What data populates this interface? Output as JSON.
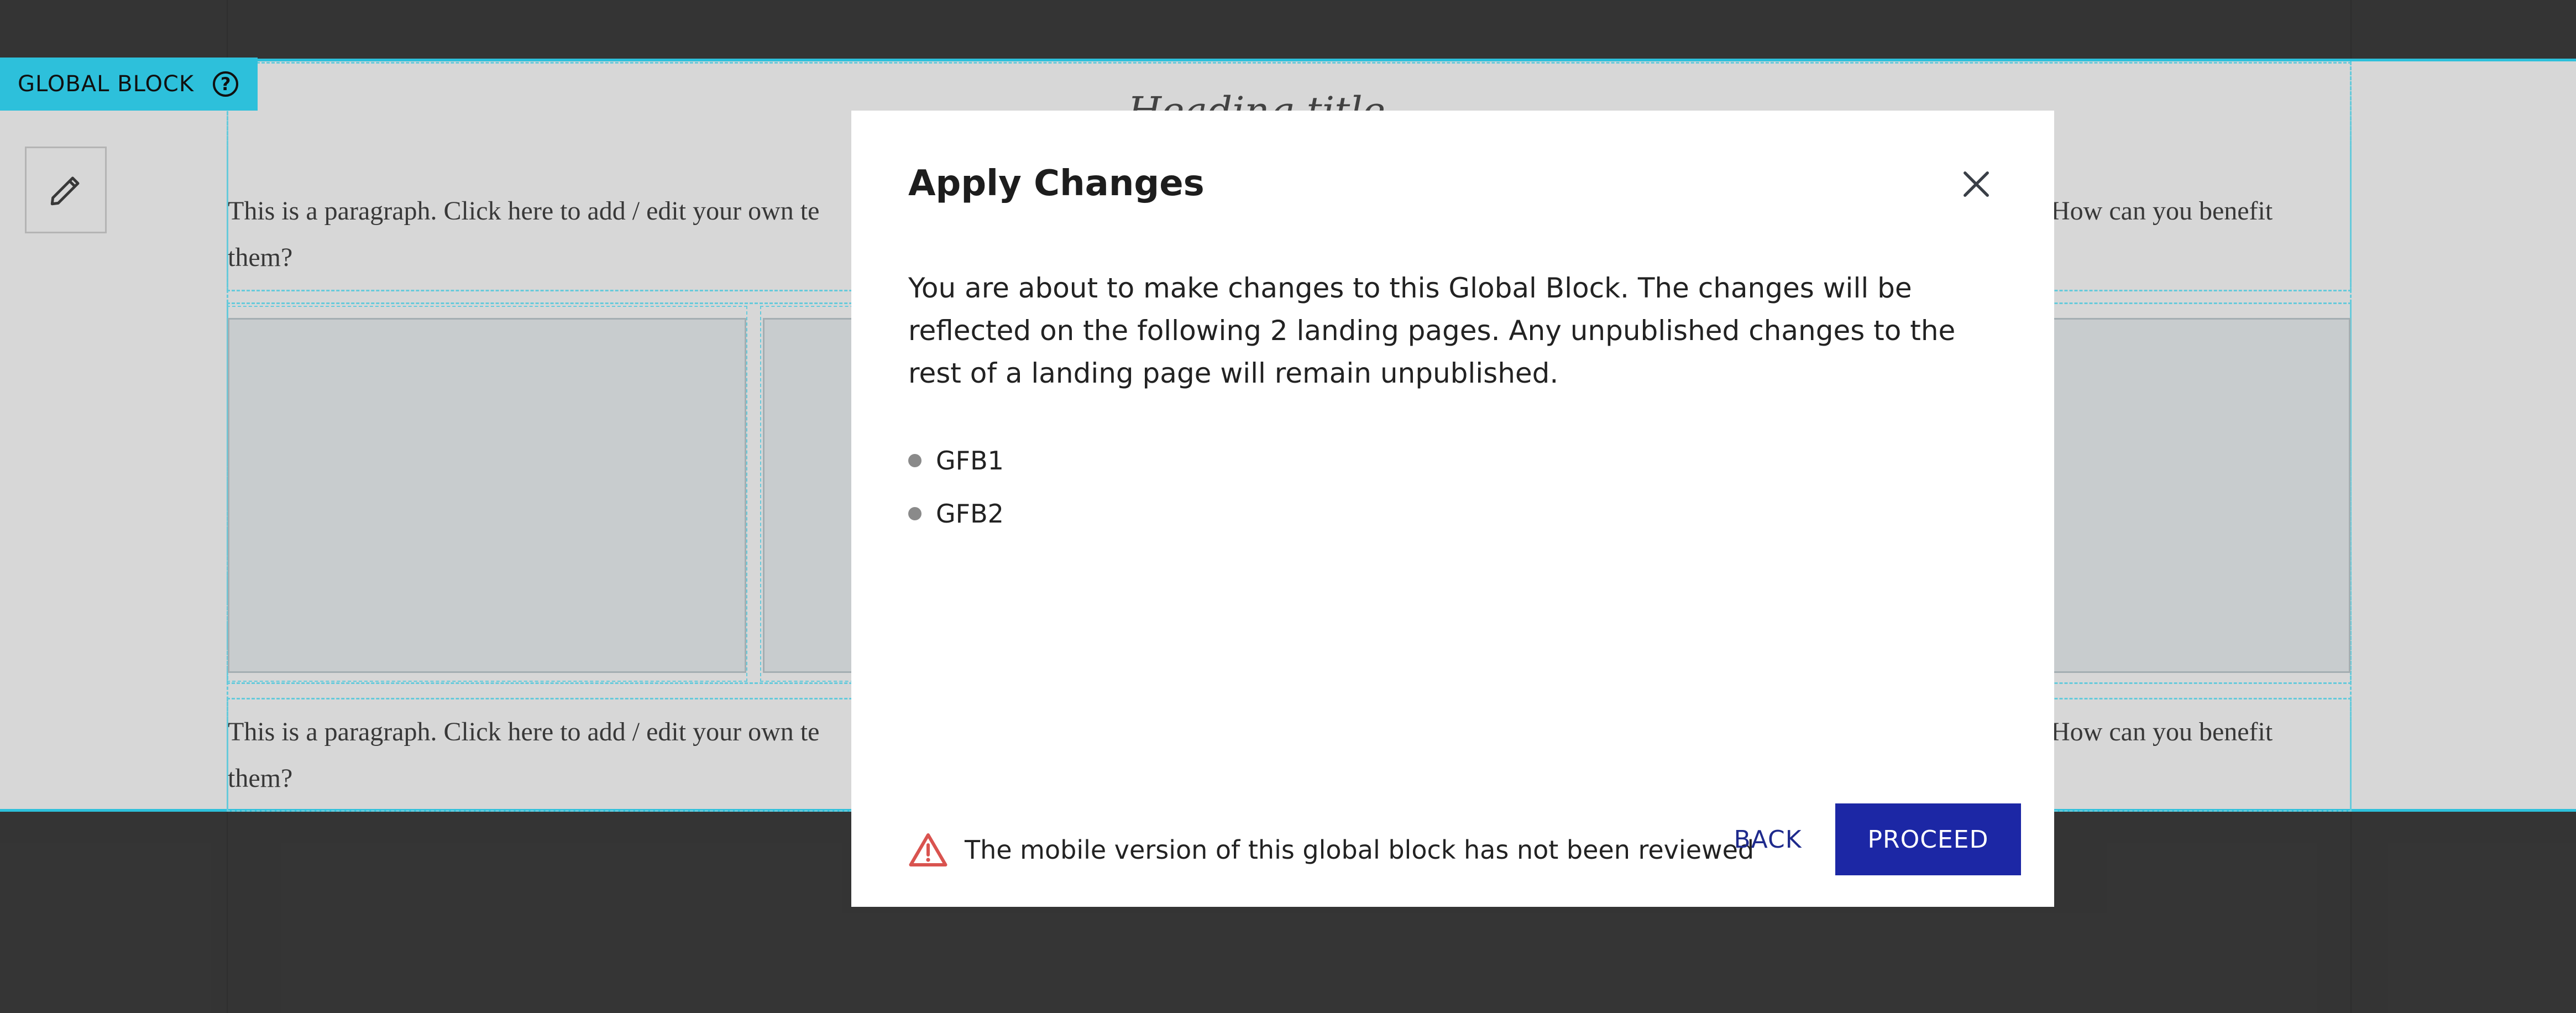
{
  "editor": {
    "global_block_label": "GLOBAL BLOCK",
    "help_icon": "question-circle-icon",
    "edit_icon": "pencil-icon",
    "heading_fragment": "Heading title",
    "paragraph_left": "This is a paragraph. Click here to add / edit your own te",
    "paragraph_right": "How can you benefit",
    "paragraph_wrap": "them?"
  },
  "modal": {
    "title": "Apply Changes",
    "close_icon": "close-icon",
    "body": "You are about to make changes to this Global Block. The changes will be reflected on the following 2 landing pages. Any unpublished changes to the rest of a landing page will remain unpublished.",
    "pages": [
      "GFB1",
      "GFB2"
    ],
    "warning_icon": "warning-triangle-icon",
    "warning_text": "The mobile version of this global block has not been reviewed",
    "back_label": "BACK",
    "proceed_label": "PROCEED"
  },
  "colors": {
    "accent_cyan": "#2ec4e0",
    "primary_button": "#1c27a5",
    "back_text": "#1e2a8c",
    "warning": "#d9534f"
  }
}
